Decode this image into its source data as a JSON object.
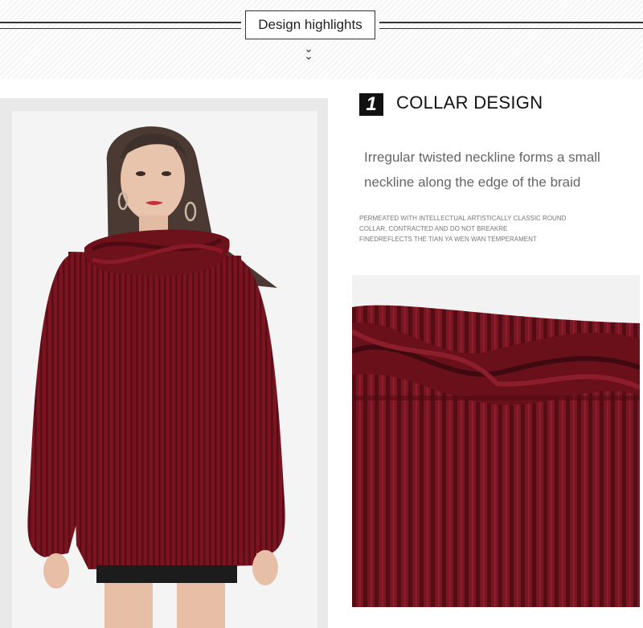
{
  "header": {
    "title": "Design highlights",
    "chevron_icon": "double-chevron-down"
  },
  "section": {
    "number": "1",
    "heading": "COLLAR DESIGN",
    "description_lines": [
      "Irregular twisted neckline forms a small",
      "neckline along the edge of the braid"
    ],
    "fine_print_lines": [
      "PERMEATED WITH INTELLECTUAL ARTISTICALLY CLASSIC ROUND",
      "COLLAR, CONTRACTED AND DO NOT BREAKRE",
      "FINEDREFLECTS THE TIAN YA WEN WAN TEMPERAMENT"
    ]
  },
  "colors": {
    "sweater": "#7a1420",
    "sweater_dark": "#5a0d16",
    "accent_black": "#111111"
  }
}
